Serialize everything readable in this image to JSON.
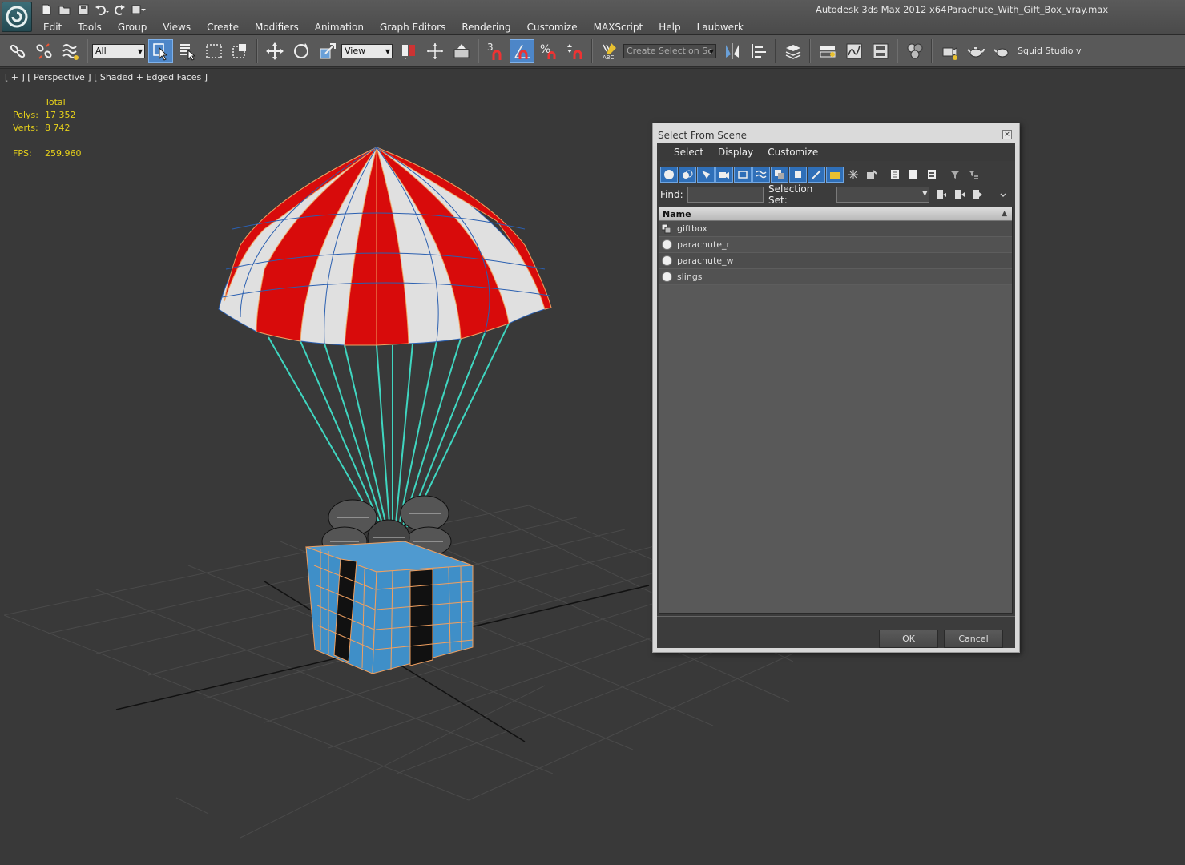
{
  "window": {
    "app_title": "Autodesk 3ds Max  2012 x64",
    "file_name": "Parachute_With_Gift_Box_vray.max"
  },
  "menu": [
    "Edit",
    "Tools",
    "Group",
    "Views",
    "Create",
    "Modifiers",
    "Animation",
    "Graph Editors",
    "Rendering",
    "Customize",
    "MAXScript",
    "Help",
    "Laubwerk"
  ],
  "toolbar": {
    "selection_filter": "All",
    "reference_coord": "View",
    "snap_label": "3",
    "named_selection": "Create Selection Se",
    "plugin_label": "Squid Studio v"
  },
  "viewport": {
    "label": "[ + ] [ Perspective ] [ Shaded + Edged Faces ]",
    "stats": {
      "total_label": "Total",
      "polys_label": "Polys:",
      "polys_value": "17 352",
      "verts_label": "Verts:",
      "verts_value": "8 742",
      "fps_label": "FPS:",
      "fps_value": "259.960"
    }
  },
  "dialog": {
    "title": "Select From Scene",
    "close_label": "×",
    "menu": [
      "Select",
      "Display",
      "Customize"
    ],
    "find_label": "Find:",
    "find_value": "",
    "selection_set_label": "Selection Set:",
    "column_name": "Name",
    "sort_glyph": "▲",
    "items": [
      {
        "label": "giftbox",
        "icon": "group-icon"
      },
      {
        "label": "parachute_r",
        "icon": "geometry-sphere-icon"
      },
      {
        "label": "parachute_w",
        "icon": "geometry-sphere-icon"
      },
      {
        "label": "slings",
        "icon": "geometry-sphere-icon"
      }
    ],
    "ok_label": "OK",
    "cancel_label": "Cancel"
  },
  "colors": {
    "accent": "#4d86c8",
    "stats_text": "#e8d21a",
    "parachute_red": "#d80b0b",
    "parachute_white": "#e0e0e0",
    "sling_color": "#3fd6c0",
    "gift_blue": "#3f8fc8",
    "selection_wire": "#f0a060"
  }
}
